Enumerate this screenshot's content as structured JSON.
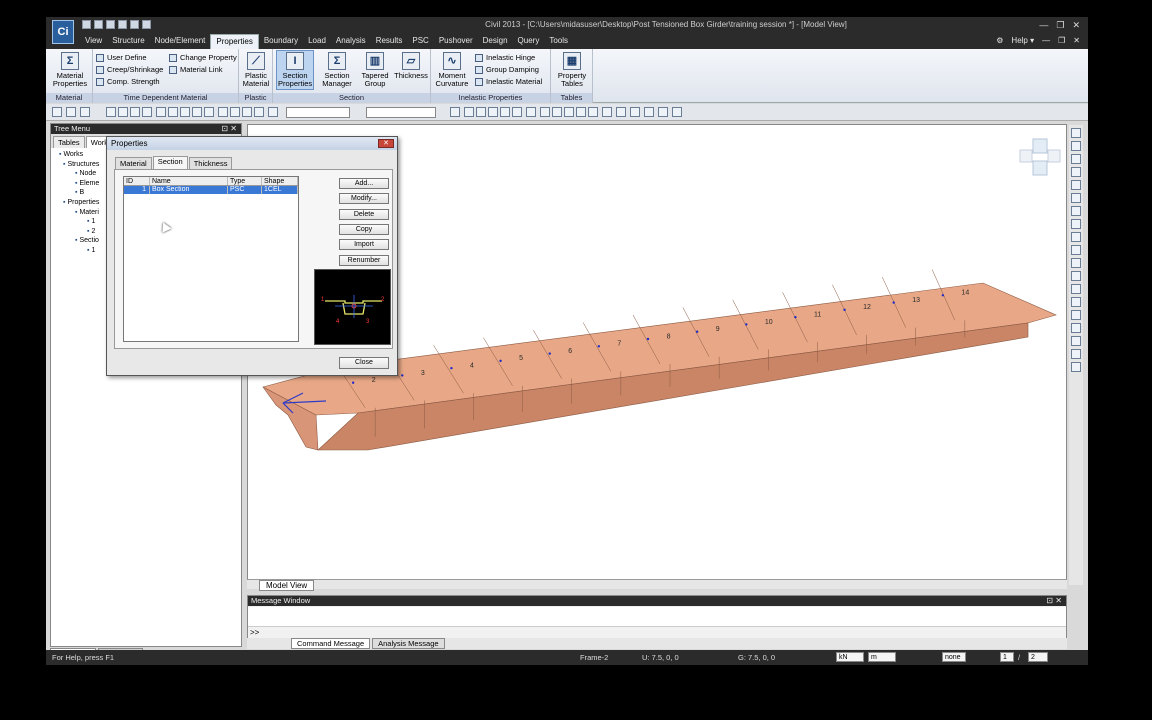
{
  "window": {
    "title": "Civil 2013 - [C:\\Users\\midasuser\\Desktop\\Post Tensioned Box Girder\\training session *] - [Model View]",
    "logo_text": "Ci",
    "minimize": "—",
    "restore": "❐",
    "close": "✕"
  },
  "menu": {
    "items": [
      "View",
      "Structure",
      "Node/Element",
      "Properties",
      "Boundary",
      "Load",
      "Analysis",
      "Results",
      "PSC",
      "Pushover",
      "Design",
      "Query",
      "Tools"
    ],
    "active": "Properties",
    "help": "Help",
    "help_arrow": "▾"
  },
  "ribbon": {
    "material_properties": "Material Properties",
    "user_define": "User Define",
    "creep_shrinkage": "Creep/Shrinkage",
    "comp_strength": "Comp. Strength",
    "change_property": "Change Property",
    "material_link": "Material Link",
    "plastic_material": "Plastic Material",
    "section_properties": "Section Properties",
    "section_manager": "Section Manager",
    "tapered_group": "Tapered Group",
    "thickness": "Thickness",
    "moment_curvature": "Moment Curvature",
    "inelastic_hinge": "Inelastic Hinge",
    "group_damping": "Group Damping",
    "inelastic_material": "Inelastic Material",
    "property_tables": "Property Tables",
    "groups": {
      "material": "Material",
      "time_dependent": "Time Dependent Material",
      "plastic": "Plastic",
      "section": "Section",
      "inelastic": "Inelastic Properties",
      "tables": "Tables"
    }
  },
  "tree": {
    "title": "Tree Menu",
    "tabs": [
      "Tables",
      "Works"
    ],
    "items": [
      "Works",
      "Structures",
      "Node",
      "Eleme",
      "B",
      "Properties",
      "Materi",
      "1",
      "2",
      "Sectio",
      "1"
    ],
    "bottom_tabs": [
      "Tree Menu",
      "Task Pane"
    ]
  },
  "dialog": {
    "title": "Properties",
    "tabs": [
      "Material",
      "Section",
      "Thickness"
    ],
    "active_tab": "Section",
    "columns": [
      "ID",
      "Name",
      "Type",
      "Shape"
    ],
    "rows": [
      {
        "id": "1",
        "name": "Box Section",
        "type": "PSC",
        "shape": "1CEL"
      }
    ],
    "buttons": [
      "Add...",
      "Modify...",
      "Delete",
      "Copy",
      "Import",
      "Renumber"
    ],
    "close": "Close",
    "preview_labels": [
      "1",
      "2",
      "4",
      "3"
    ]
  },
  "view": {
    "tab": "Model View",
    "segment_labels": [
      "2",
      "3",
      "4",
      "5",
      "6",
      "7",
      "8",
      "9",
      "10",
      "11",
      "12",
      "13",
      "14"
    ]
  },
  "message": {
    "title": "Message Window",
    "prompt": ">>",
    "tabs": [
      "Command Message",
      "Analysis Message"
    ]
  },
  "status": {
    "help": "For Help, press F1",
    "frame": "Frame-2",
    "u": "U: 7.5, 0, 0",
    "g": "G: 7.5, 0, 0",
    "force_unit": "kN",
    "length_unit": "m",
    "mode": "none",
    "page_current": "1",
    "page_total": "2"
  },
  "colors": {
    "girder": "#e8a887",
    "girder_side": "#c98565",
    "selection": "#3a78d6"
  }
}
